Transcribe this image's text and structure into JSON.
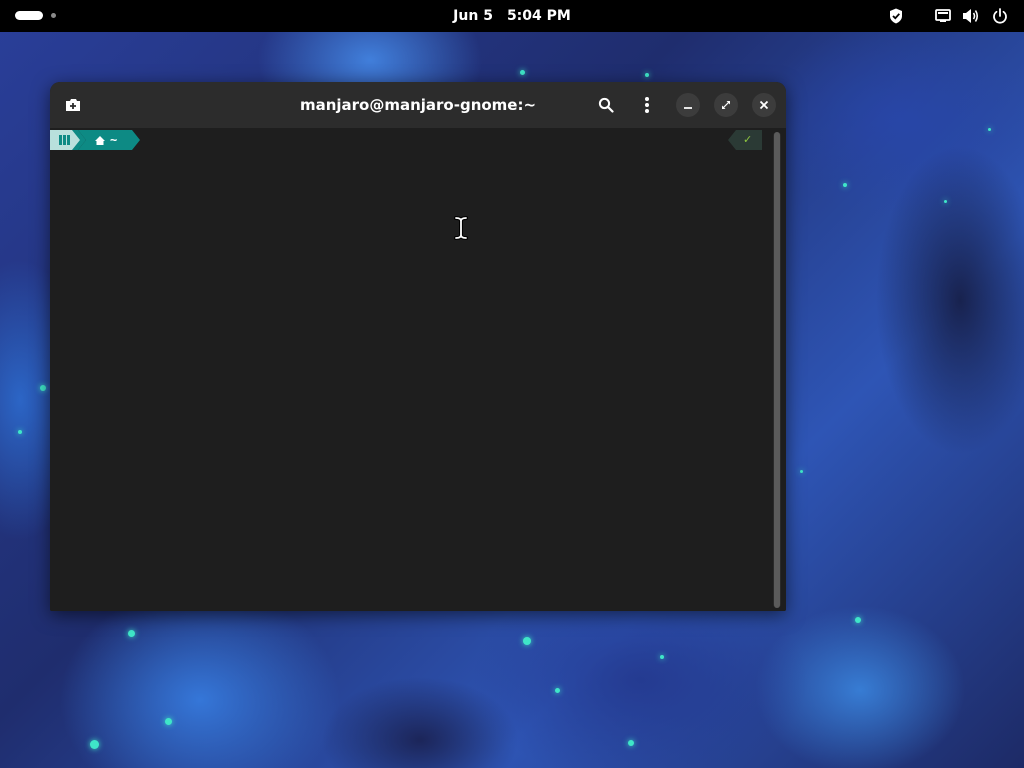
{
  "topbar": {
    "date": "Jun 5",
    "time": "5:04 PM",
    "icons": [
      "shield-icon",
      "network-icon",
      "volume-icon",
      "power-icon"
    ]
  },
  "terminal": {
    "title": "manjaro@manjaro-gnome:~",
    "headerbar_icons": [
      "new-tab-icon",
      "search-icon",
      "menu-icon",
      "minimize-icon",
      "maximize-icon",
      "close-icon"
    ],
    "prompt": {
      "home_icon": "home-icon",
      "directory": "~",
      "status_symbol": "✓"
    },
    "colors": {
      "prompt_accent": "#0d8a84",
      "prompt_os": "#b9e0dc",
      "status_ok": "#8ec63f",
      "background": "#1e1e1e",
      "headerbar": "#2c2c2c"
    }
  }
}
